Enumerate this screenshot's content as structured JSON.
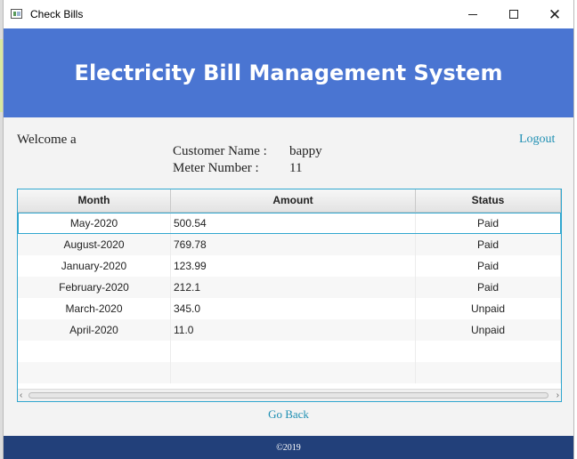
{
  "window": {
    "title": "Check Bills",
    "minimize_icon": "minimize-icon",
    "maximize_icon": "maximize-icon",
    "close_glyph": "✕"
  },
  "header": {
    "title": "Electricity Bill Management System",
    "color": "#4a75d2"
  },
  "welcome": "Welcome  a",
  "logout": "Logout",
  "customer": {
    "name_label": "Customer Name :",
    "name_value": "bappy",
    "meter_label": "Meter Number :",
    "meter_value": "11"
  },
  "table": {
    "columns": [
      "Month",
      "Amount",
      "Status"
    ],
    "rows": [
      {
        "month": "May-2020",
        "amount": "500.54",
        "status": "Paid"
      },
      {
        "month": "August-2020",
        "amount": "769.78",
        "status": "Paid"
      },
      {
        "month": "January-2020",
        "amount": "123.99",
        "status": "Paid"
      },
      {
        "month": "February-2020",
        "amount": "212.1",
        "status": "Paid"
      },
      {
        "month": "March-2020",
        "amount": "345.0",
        "status": "Unpaid"
      },
      {
        "month": "April-2020",
        "amount": "11.0",
        "status": "Unpaid"
      }
    ],
    "selected_row": 0
  },
  "go_back": "Go Back",
  "footer": "©2019",
  "colors": {
    "accent": "#30a7cf",
    "link": "#1f8fb3",
    "footer": "#22407a"
  }
}
